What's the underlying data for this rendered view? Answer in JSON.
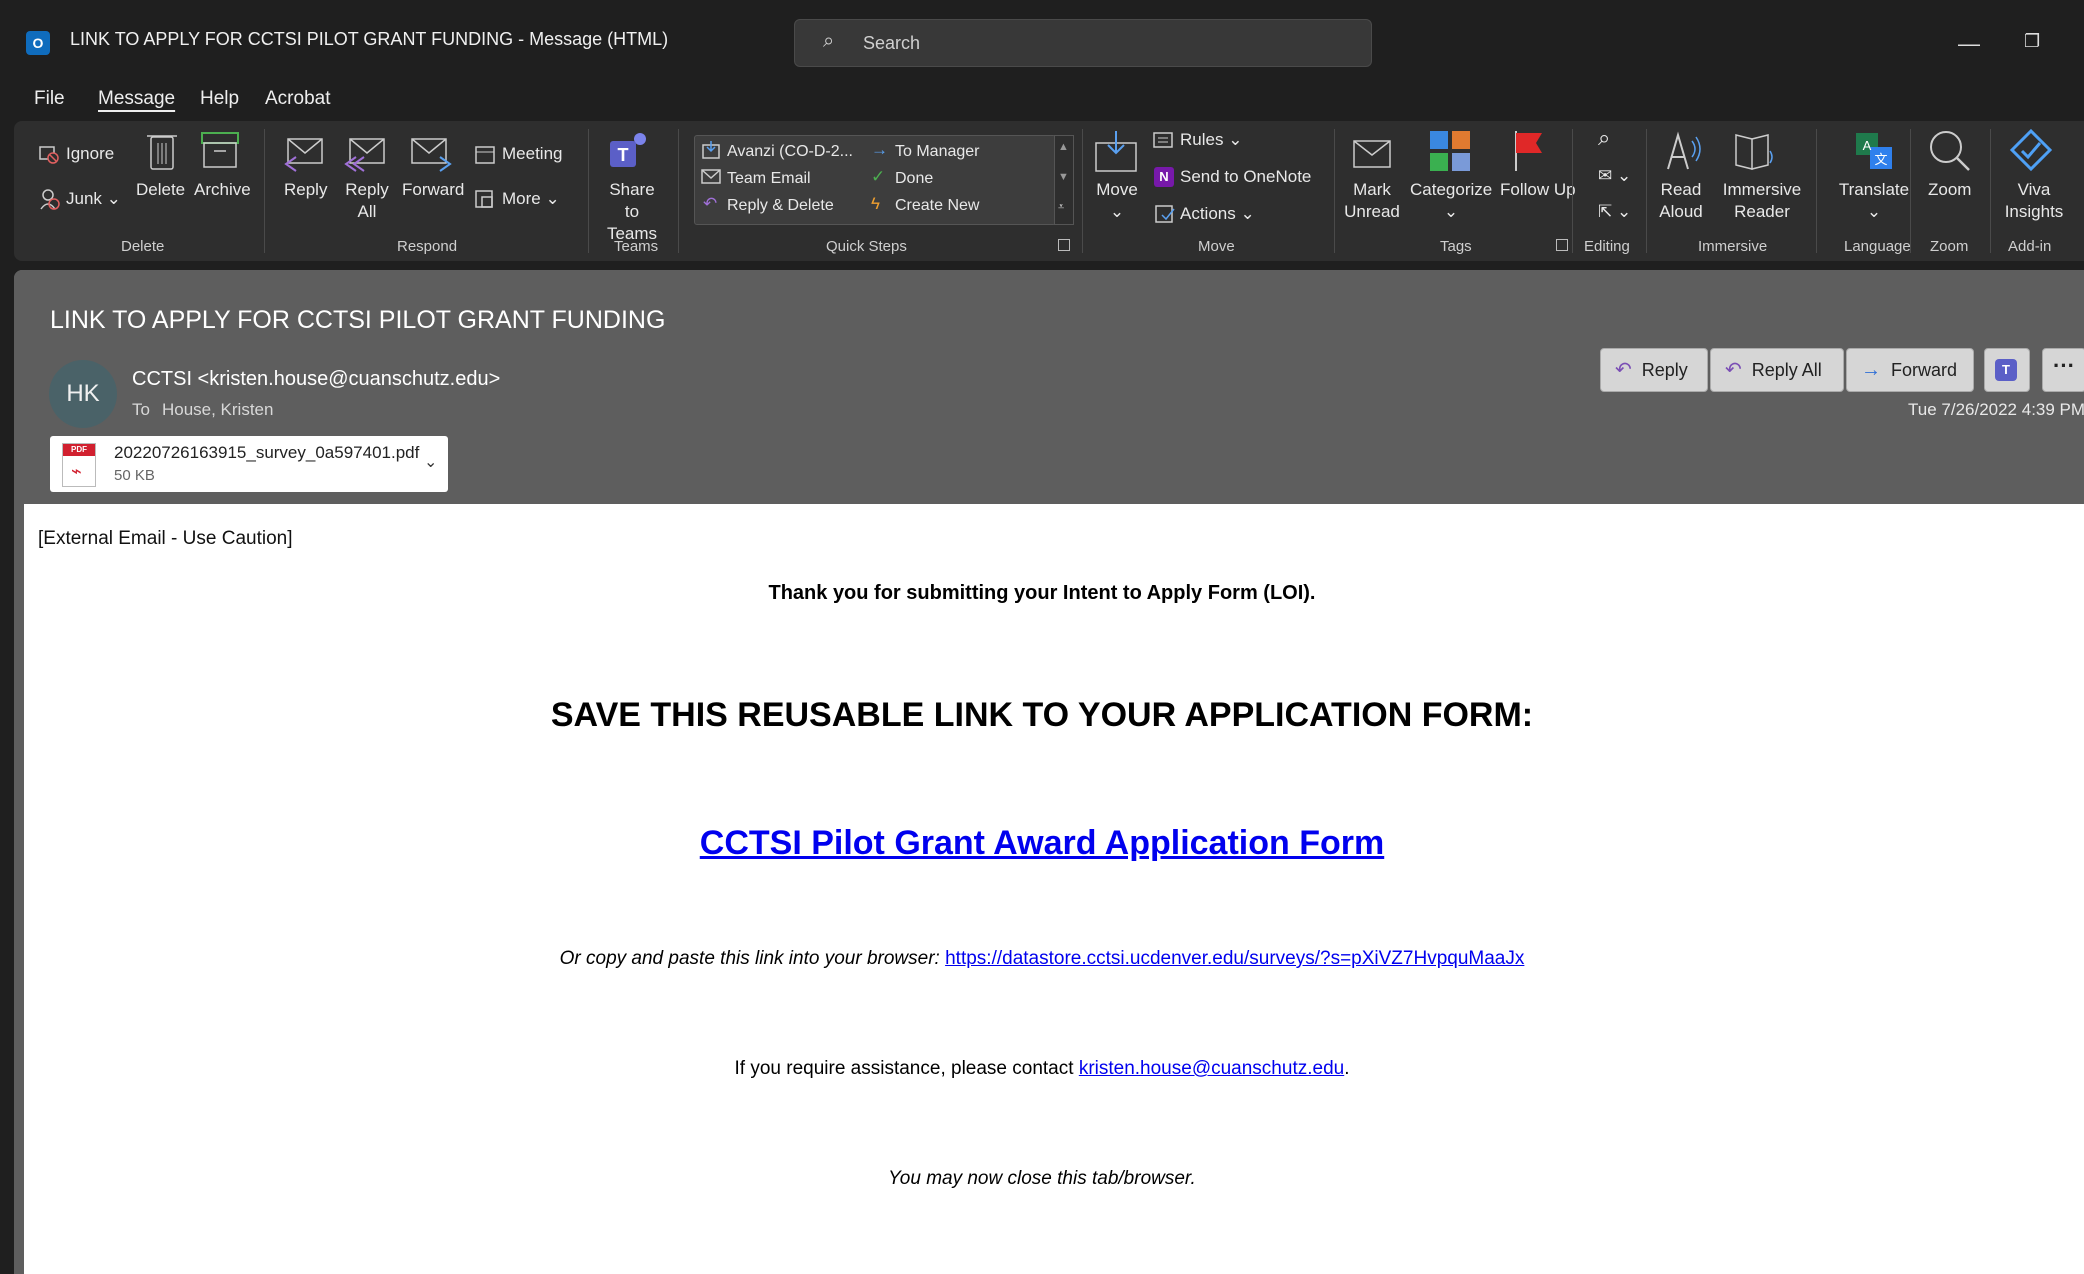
{
  "window": {
    "title": "LINK TO APPLY FOR CCTSI PILOT GRANT FUNDING  -  Message (HTML)",
    "app_icon": "outlook-icon",
    "minimize_glyph": "—",
    "restore_glyph": "❐"
  },
  "search": {
    "placeholder": "Search"
  },
  "menu": [
    "File",
    "Message",
    "Help",
    "Acrobat"
  ],
  "ribbon": {
    "delete": {
      "ignore": "Ignore",
      "junk": "Junk",
      "delete": "Delete",
      "archive": "Archive",
      "group": "Delete"
    },
    "respond": {
      "reply": "Reply",
      "reply_all": "Reply All",
      "forward": "Forward",
      "meeting": "Meeting",
      "more": "More",
      "group": "Respond"
    },
    "teams": {
      "share": "Share to Teams",
      "group": "Teams"
    },
    "quick_steps": {
      "items": [
        "Avanzi (CO-D-2...",
        "To Manager",
        "Team Email",
        "Done",
        "Reply & Delete",
        "Create New"
      ],
      "group": "Quick Steps"
    },
    "move": {
      "move": "Move",
      "rules": "Rules",
      "onenote": "Send to OneNote",
      "actions": "Actions",
      "group": "Move"
    },
    "tags": {
      "mark_unread": "Mark Unread",
      "categorize": "Categorize",
      "follow_up": "Follow Up",
      "group": "Tags"
    },
    "editing": {
      "group": "Editing"
    },
    "immersive": {
      "read_aloud": "Read Aloud",
      "immersive_reader": "Immersive Reader",
      "group": "Immersive"
    },
    "language": {
      "translate": "Translate",
      "group": "Language"
    },
    "zoom": {
      "zoom": "Zoom",
      "group": "Zoom"
    },
    "addin": {
      "viva": "Viva Insights",
      "group": "Add-in"
    }
  },
  "message": {
    "subject": "LINK TO APPLY FOR CCTSI PILOT GRANT FUNDING",
    "avatar_initials": "HK",
    "sender": "CCTSI <kristen.house@cuanschutz.edu>",
    "to_label": "To",
    "to_name": "House, Kristen",
    "date": "Tue 7/26/2022 4:39 PM",
    "actions": {
      "reply": "Reply",
      "reply_all": "Reply All",
      "forward": "Forward",
      "more": "···"
    },
    "attachment": {
      "name": "20220726163915_survey_0a597401.pdf",
      "size": "50 KB"
    }
  },
  "body": {
    "warning": "[External Email - Use Caution]",
    "thanks": "Thank you for submitting your Intent to Apply Form (LOI).",
    "heading": "SAVE THIS REUSABLE LINK TO YOUR APPLICATION FORM:",
    "form_link": "CCTSI Pilot Grant Award Application Form",
    "copy_text": "Or copy and paste this link into your browser: ",
    "copy_url": "https://datastore.cctsi.ucdenver.edu/surveys/?s=pXiVZ7HvpquMaaJx",
    "assist_text": "If you require assistance, please contact ",
    "assist_email": "kristen.house@cuanschutz.edu",
    "assist_end": ".",
    "close_text": "You may now close this tab/browser."
  },
  "colors": {
    "link": "#0000ee",
    "accent": "#0f6cbd",
    "chrome": "#1f1f1f",
    "ribbon": "#2e2e2e",
    "header": "#5e5e5e"
  }
}
